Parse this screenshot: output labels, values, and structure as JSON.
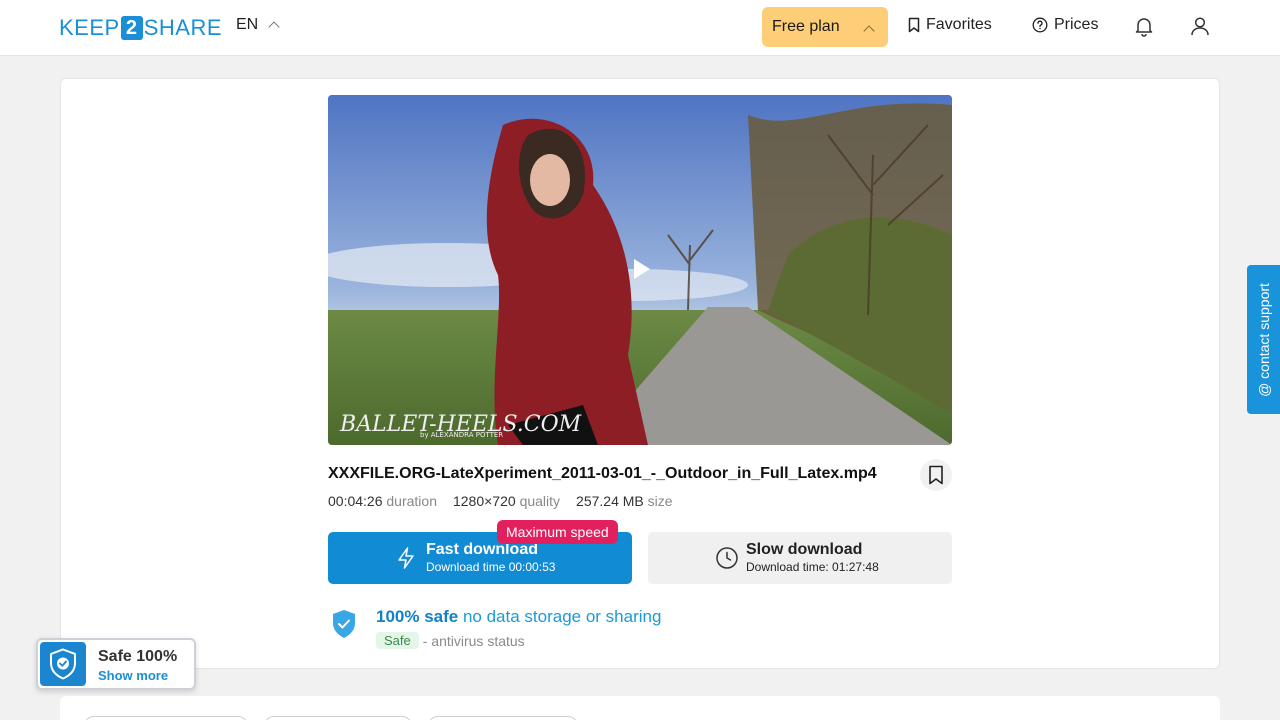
{
  "header": {
    "logo_left": "KEEP",
    "logo_mid": "2",
    "logo_right": "SHARE",
    "language": "EN",
    "plan_label": "Free plan",
    "favorites_label": "Favorites",
    "prices_label": "Prices"
  },
  "file": {
    "name": "XXXFILE.ORG-LateXperiment_2011-03-01_-_Outdoor_in_Full_Latex.mp4",
    "duration_value": "00:04:26",
    "duration_label": "duration",
    "quality_value": "1280×720",
    "quality_label": "quality",
    "size_value": "257.24 MB",
    "size_label": "size",
    "watermark": "BALLET-HEELS.COM",
    "watermark_sub": "by ALEXANDRA POTTER"
  },
  "download": {
    "fast_title": "Fast download",
    "fast_sub": "Download time 00:00:53",
    "max_speed_badge": "Maximum speed",
    "slow_title": "Slow download",
    "slow_sub": "Download time: 01:27:48"
  },
  "safety": {
    "safe_bold": "100% safe",
    "safe_rest": "no data storage or sharing",
    "badge": "Safe",
    "status_text": "- antivirus status"
  },
  "contact_support": "@ contact support",
  "safe_widget": {
    "title": "Safe 100%",
    "link": "Show more"
  },
  "colors": {
    "brand": "#1b8fd6",
    "fast_button": "#128bd5",
    "plan_button": "#fdce77",
    "badge": "#e3205e"
  }
}
